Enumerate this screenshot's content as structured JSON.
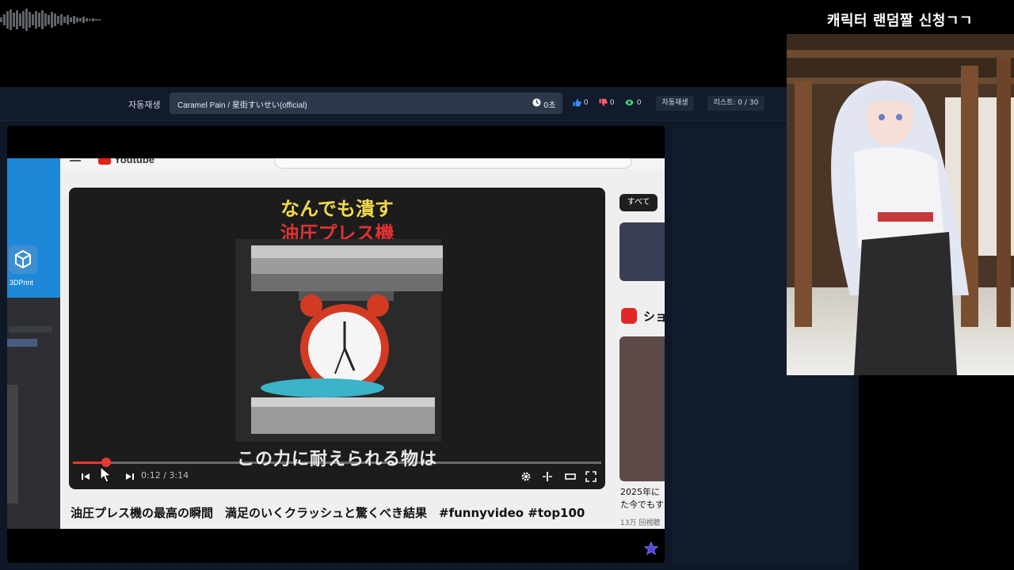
{
  "overlay": {
    "title": "캐릭터 랜덤짤 신청ㄱㄱ"
  },
  "toolbar": {
    "autoplay_label": "자동재생",
    "song_title": "Caramel Pain / 星街すいせい(official)",
    "timer": "0초",
    "likes": "0",
    "dislikes": "0",
    "views": "0",
    "autoplay_button": "자동재생",
    "list_button": "리스트: 0 / 30"
  },
  "youtube": {
    "logo_text": "Youtube",
    "sidebar_app_label": "3DPrint",
    "video_caption_line1": "なんでも潰す",
    "video_caption_line2": "油圧プレス機",
    "video_subtitle": "この力に耐えられる物は",
    "progress": 0.063,
    "time_current": "0:12",
    "time_total": "3:14",
    "video_title": "油圧プレス機の最高の瞬間　満足のいくクラッシュと驚くべき結果　#funnyvideo #top100",
    "chip_all": "すべて",
    "shorts_label": "ショ",
    "side_title_line1": "2025年に",
    "side_title_line2": "た今でもす",
    "side_views": "13万 回視聴"
  },
  "icons": {
    "timer": "clock-icon",
    "likes": "thumbs-up-icon",
    "dislikes": "thumbs-down-icon",
    "views": "eye-icon",
    "star": "star-icon"
  },
  "colors": {
    "like": "#3f8cff",
    "dislike": "#ff5a6e",
    "view": "#3ddc84",
    "accent_red": "#e53935"
  }
}
